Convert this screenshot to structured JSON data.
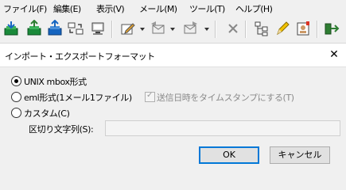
{
  "menu": {
    "file": "ファイル(F)",
    "edit": "編集(E)",
    "view": "表示(V)",
    "mail": "メール(M)",
    "tools": "ツール(T)",
    "help": "ヘルプ(H)"
  },
  "toolbar": {
    "icons": [
      "mailbox-receive-icon",
      "mailbox-green-icon",
      "mailbox-blue-icon",
      "sync-icon",
      "computer-icon",
      "compose-icon",
      "reply-icon",
      "forward-icon",
      "delete-icon",
      "tree-icon",
      "edit-pencil-icon",
      "address-book-icon",
      "exit-icon"
    ]
  },
  "dialog": {
    "title": "インポート・エクスポートフォーマット",
    "close_glyph": "✕",
    "options": {
      "unix_mbox": "UNIX mbox形式",
      "eml": "eml形式(1メール1ファイル)",
      "timestamp_checkbox": "送信日時をタイムスタンプにする(T)",
      "custom": "カスタム(C)",
      "delimiter_label": "区切り文字列(S):",
      "delimiter_value": ""
    },
    "selected": "unix_mbox",
    "timestamp_checked": true,
    "ok_label": "OK",
    "cancel_label": "キャンセル"
  }
}
